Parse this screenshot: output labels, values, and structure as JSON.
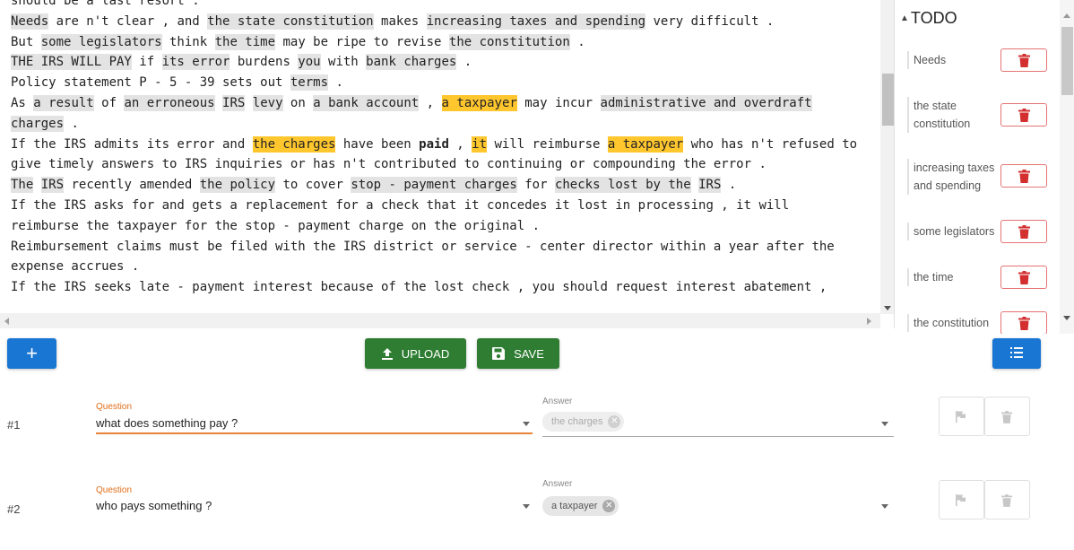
{
  "document": {
    "lines": [
      [
        {
          "t": "should be a last resort ."
        }
      ],
      [
        {
          "t": "Needs",
          "h": "gray"
        },
        {
          "t": " are n't clear , and "
        },
        {
          "t": "the state constitution",
          "h": "gray"
        },
        {
          "t": " makes "
        },
        {
          "t": "increasing taxes and spending",
          "h": "gray"
        },
        {
          "t": " very difficult ."
        }
      ],
      [
        {
          "t": "But "
        },
        {
          "t": "some legislators",
          "h": "gray"
        },
        {
          "t": " think "
        },
        {
          "t": "the time",
          "h": "gray"
        },
        {
          "t": " may be ripe to revise "
        },
        {
          "t": "the constitution",
          "h": "gray"
        },
        {
          "t": " ."
        }
      ],
      [
        {
          "t": "THE IRS WILL PAY",
          "h": "gray"
        },
        {
          "t": " if "
        },
        {
          "t": "its error",
          "h": "gray"
        },
        {
          "t": " burdens "
        },
        {
          "t": "you",
          "h": "gray"
        },
        {
          "t": " with "
        },
        {
          "t": "bank charges",
          "h": "gray"
        },
        {
          "t": " ."
        }
      ],
      [
        {
          "t": "Policy statement P - 5 - 39 sets out "
        },
        {
          "t": "terms",
          "h": "gray"
        },
        {
          "t": " ."
        }
      ],
      [
        {
          "t": "As "
        },
        {
          "t": "a result",
          "h": "gray"
        },
        {
          "t": " of "
        },
        {
          "t": "an erroneous",
          "h": "gray"
        },
        {
          "t": " "
        },
        {
          "t": "IRS",
          "h": "gray"
        },
        {
          "t": " "
        },
        {
          "t": "levy",
          "h": "gray"
        },
        {
          "t": " on "
        },
        {
          "t": "a bank account",
          "h": "gray"
        },
        {
          "t": " , "
        },
        {
          "t": "a taxpayer",
          "h": "orange"
        },
        {
          "t": " may incur "
        },
        {
          "t": "administrative and overdraft",
          "h": "gray"
        }
      ],
      [
        {
          "t": "charges",
          "h": "gray"
        },
        {
          "t": " ."
        }
      ],
      [
        {
          "t": "If the IRS admits its error and "
        },
        {
          "t": "the charges",
          "h": "orange"
        },
        {
          "t": " have been "
        },
        {
          "t": "paid",
          "b": true
        },
        {
          "t": " , "
        },
        {
          "t": "it",
          "h": "orange"
        },
        {
          "t": " will reimburse "
        },
        {
          "t": "a taxpayer",
          "h": "orange"
        },
        {
          "t": " who has n't refused to"
        }
      ],
      [
        {
          "t": "give timely answers to IRS inquiries or has n't contributed to continuing or compounding the error ."
        }
      ],
      [
        {
          "t": "The",
          "h": "gray"
        },
        {
          "t": " "
        },
        {
          "t": "IRS",
          "h": "gray"
        },
        {
          "t": " recently amended "
        },
        {
          "t": "the policy",
          "h": "gray"
        },
        {
          "t": " to cover "
        },
        {
          "t": "stop - payment charges",
          "h": "gray"
        },
        {
          "t": " for "
        },
        {
          "t": "checks lost by the",
          "h": "gray"
        },
        {
          "t": " "
        },
        {
          "t": "IRS",
          "h": "gray"
        },
        {
          "t": " ."
        }
      ],
      [
        {
          "t": "If the IRS asks for and gets a replacement for a check that it concedes it lost in processing , it will"
        }
      ],
      [
        {
          "t": "reimburse the taxpayer for the stop - payment charge on the original ."
        }
      ],
      [
        {
          "t": "Reimbursement claims must be filed with the IRS district or service - center director within a year after the"
        }
      ],
      [
        {
          "t": "expense accrues ."
        }
      ],
      [
        {
          "t": "If the IRS seeks late - payment interest because of the lost check , you should request interest abatement ,"
        }
      ]
    ]
  },
  "todo": {
    "title": "TODO",
    "items": [
      {
        "label": "Needs"
      },
      {
        "label": "the state constitution"
      },
      {
        "label": "increasing taxes and spending"
      },
      {
        "label": "some legislators"
      },
      {
        "label": "the time"
      },
      {
        "label": "the constitution"
      }
    ]
  },
  "toolbar": {
    "add_label": "+",
    "upload_label": "UPLOAD",
    "save_label": "SAVE"
  },
  "questions": [
    {
      "number": "#1",
      "question_label": "Question",
      "question": "what does something pay  ?",
      "answer_label": "Answer",
      "answer_chip": "the charges",
      "active": true
    },
    {
      "number": "#2",
      "question_label": "Question",
      "question": "who pays something  ?",
      "answer_label": "Answer",
      "answer_chip": "a taxpayer",
      "active": false
    }
  ],
  "colors": {
    "primary": "#1976d2",
    "success": "#2e7d32",
    "danger": "#d32f2f",
    "highlight_gray": "#e3e3e3",
    "highlight_orange": "#ffc62e",
    "focus": "#e8833a"
  },
  "icons": {
    "upload": "upload-icon",
    "save": "floppy-disk-icon",
    "list": "list-icon",
    "delete": "trash-icon",
    "flag": "flag-icon"
  }
}
